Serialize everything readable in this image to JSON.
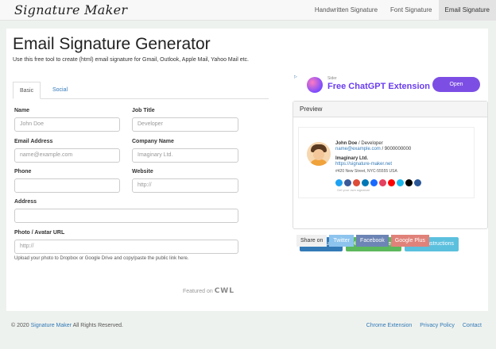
{
  "nav": {
    "logo": "Signature Maker",
    "links": [
      "Handwritten Signature",
      "Font Signature",
      "Email Signature"
    ]
  },
  "main": {
    "title": "Email Signature Generator",
    "subtitle": "Use this free tool to create (html) email signature for Gmail, Outlook, Apple Mail, Yahoo Mail etc.",
    "tabs": [
      "Basic",
      "Social"
    ]
  },
  "form": {
    "name_label": "Name",
    "name_placeholder": "John Doe",
    "job_label": "Job Title",
    "job_placeholder": "Developer",
    "email_label": "Email Address",
    "email_placeholder": "name@example.com",
    "company_label": "Company Name",
    "company_placeholder": "Imaginary Ltd.",
    "phone_label": "Phone",
    "phone_placeholder": "",
    "website_label": "Website",
    "website_placeholder": "http://",
    "address_label": "Address",
    "address_placeholder": "",
    "photo_label": "Photo / Avatar URL",
    "photo_placeholder": "http://",
    "photo_help": "Upload your photo to Dropbox or Google Drive and copy/paste the public link here."
  },
  "featured": {
    "prefix": "Featured on",
    "brand": "CWL"
  },
  "ad": {
    "small": "Sider",
    "title": "Free ChatGPT Extension",
    "button": "Open"
  },
  "preview": {
    "heading": "Preview",
    "name": "John Doe",
    "job": "Developer",
    "email": "name@example.com",
    "phone": "9000000000",
    "company": "Imaginary Ltd.",
    "url": "https://signature-maker.net",
    "address": "#420 New Street, NYC-55555 USA",
    "own": "Get your own signature",
    "icon_colors": [
      "#1da1f2",
      "#3b5998",
      "#dd4b39",
      "#0077b5",
      "#1769ff",
      "#e4405f",
      "#ff0000",
      "#1ab7ea",
      "#000000",
      "#2b5797"
    ]
  },
  "buttons": {
    "view_source": "View Source",
    "highlight": "Highlight & Select",
    "setup": "Setup Instructions"
  },
  "share": {
    "label": "Share on",
    "twitter": "Twitter",
    "facebook": "Facebook",
    "google": "Google Plus"
  },
  "footer": {
    "copy_prefix": "© 2020",
    "brand": "Signature Maker",
    "copy_suffix": "All Rights Reserved.",
    "links": [
      "Chrome Extension",
      "Privacy Policy",
      "Contact"
    ]
  }
}
